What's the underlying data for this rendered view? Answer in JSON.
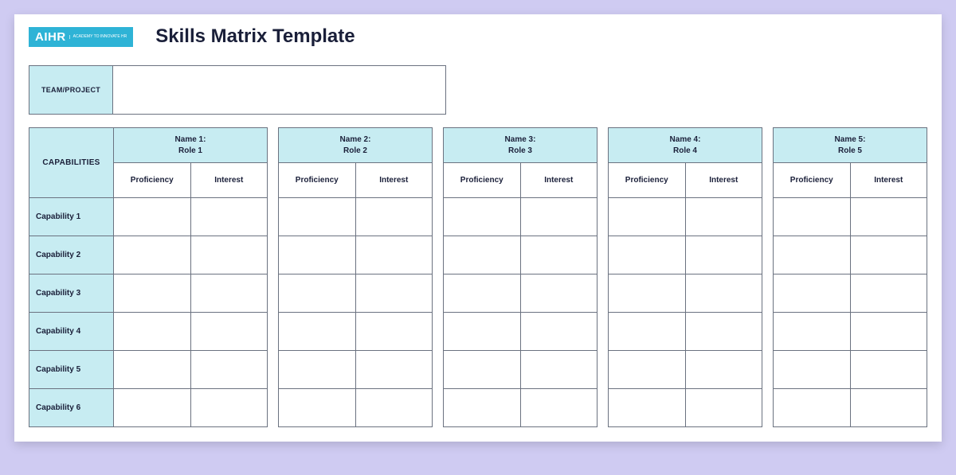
{
  "logo": {
    "main": "AIHR",
    "sub": "ACADEMY TO\nINNOVATE HR"
  },
  "title": "Skills Matrix Template",
  "team_label": "TEAM/PROJECT",
  "team_value": "",
  "capabilities_header": "CAPABILITIES",
  "sub_headers": {
    "proficiency": "Proficiency",
    "interest": "Interest"
  },
  "people": [
    {
      "name": "Name 1:",
      "role": "Role 1"
    },
    {
      "name": "Name 2:",
      "role": "Role 2"
    },
    {
      "name": "Name 3:",
      "role": "Role 3"
    },
    {
      "name": "Name 4:",
      "role": "Role 4"
    },
    {
      "name": "Name 5:",
      "role": "Role 5"
    }
  ],
  "capabilities": [
    "Capability 1",
    "Capability 2",
    "Capability 3",
    "Capability 4",
    "Capability 5",
    "Capability 6"
  ],
  "chart_data": {
    "type": "table",
    "title": "Skills Matrix Template",
    "row_labels": [
      "Capability 1",
      "Capability 2",
      "Capability 3",
      "Capability 4",
      "Capability 5",
      "Capability 6"
    ],
    "column_groups": [
      {
        "name": "Name 1:",
        "role": "Role 1",
        "sub": [
          "Proficiency",
          "Interest"
        ]
      },
      {
        "name": "Name 2:",
        "role": "Role 2",
        "sub": [
          "Proficiency",
          "Interest"
        ]
      },
      {
        "name": "Name 3:",
        "role": "Role 3",
        "sub": [
          "Proficiency",
          "Interest"
        ]
      },
      {
        "name": "Name 4:",
        "role": "Role 4",
        "sub": [
          "Proficiency",
          "Interest"
        ]
      },
      {
        "name": "Name 5:",
        "role": "Role 5",
        "sub": [
          "Proficiency",
          "Interest"
        ]
      }
    ],
    "values": [
      [
        null,
        null,
        null,
        null,
        null,
        null,
        null,
        null,
        null,
        null
      ],
      [
        null,
        null,
        null,
        null,
        null,
        null,
        null,
        null,
        null,
        null
      ],
      [
        null,
        null,
        null,
        null,
        null,
        null,
        null,
        null,
        null,
        null
      ],
      [
        null,
        null,
        null,
        null,
        null,
        null,
        null,
        null,
        null,
        null
      ],
      [
        null,
        null,
        null,
        null,
        null,
        null,
        null,
        null,
        null,
        null
      ],
      [
        null,
        null,
        null,
        null,
        null,
        null,
        null,
        null,
        null,
        null
      ]
    ]
  }
}
